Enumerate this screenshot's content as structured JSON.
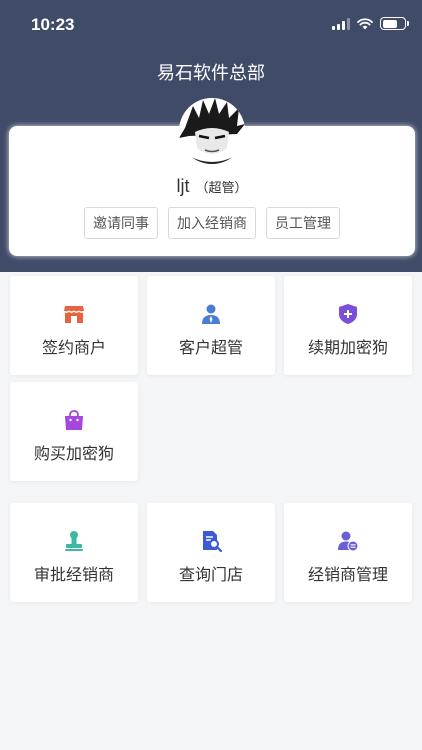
{
  "status_bar": {
    "time": "10:23"
  },
  "header": {
    "title": "易石软件总部"
  },
  "profile": {
    "name": "ljt",
    "role": "（超管）",
    "actions": [
      "邀请同事",
      "加入经销商",
      "员工管理"
    ]
  },
  "menu_group_1": [
    {
      "label": "签约商户",
      "icon": "store-icon",
      "color": "#e8623d"
    },
    {
      "label": "客户超管",
      "icon": "admin-user-icon",
      "color": "#4a7bd5"
    },
    {
      "label": "续期加密狗",
      "icon": "shield-plus-icon",
      "color": "#7b4fd8"
    },
    {
      "label": "购买加密狗",
      "icon": "shopping-bag-icon",
      "color": "#a646e0"
    }
  ],
  "menu_group_2": [
    {
      "label": "审批经销商",
      "icon": "stamp-icon",
      "color": "#3fb8a2"
    },
    {
      "label": "查询门店",
      "icon": "document-search-icon",
      "color": "#3b5bd6"
    },
    {
      "label": "经销商管理",
      "icon": "user-manage-icon",
      "color": "#6a5fd4"
    }
  ],
  "colors": {
    "header_bg": "#404b68",
    "page_bg": "#f4f5f7"
  }
}
